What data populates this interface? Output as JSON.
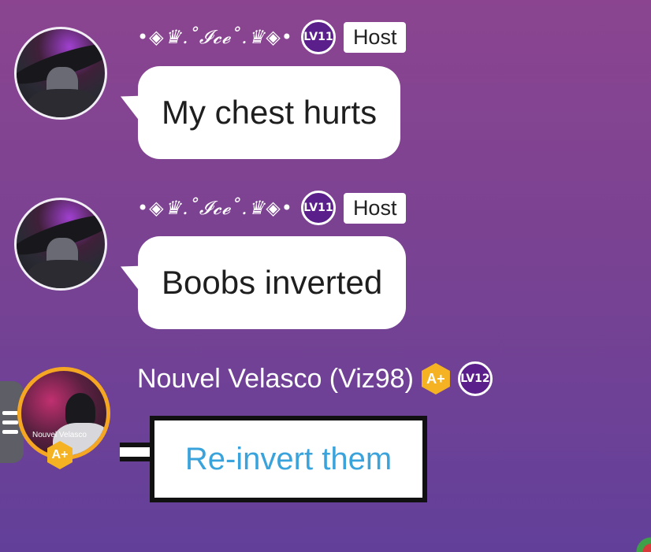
{
  "messages": [
    {
      "sender": "•◈♛.˚𝓘𝓬𝓮˚.♛◈•",
      "level": "LV11",
      "role": "Host",
      "text": "My chest hurts"
    },
    {
      "sender": "•◈♛.˚𝓘𝓬𝓮˚.♛◈•",
      "level": "LV11",
      "role": "Host",
      "text": "Boobs inverted"
    },
    {
      "sender": "Nouvel Velasco (Viz98)",
      "badge": "A+",
      "level": "LV12",
      "avatar_label": "Nouvel Velasco",
      "text": "Re-invert them"
    }
  ],
  "colors": {
    "background_top": "#8b4590",
    "background_bottom": "#62409a",
    "reply_text": "#3aa3dc",
    "gold_badge": "#f5b323",
    "level_badge": "#5a1f8a"
  },
  "icons": {
    "menu": "hamburger-menu-icon",
    "level": "level-badge-icon",
    "premium": "amino-plus-badge-icon"
  }
}
